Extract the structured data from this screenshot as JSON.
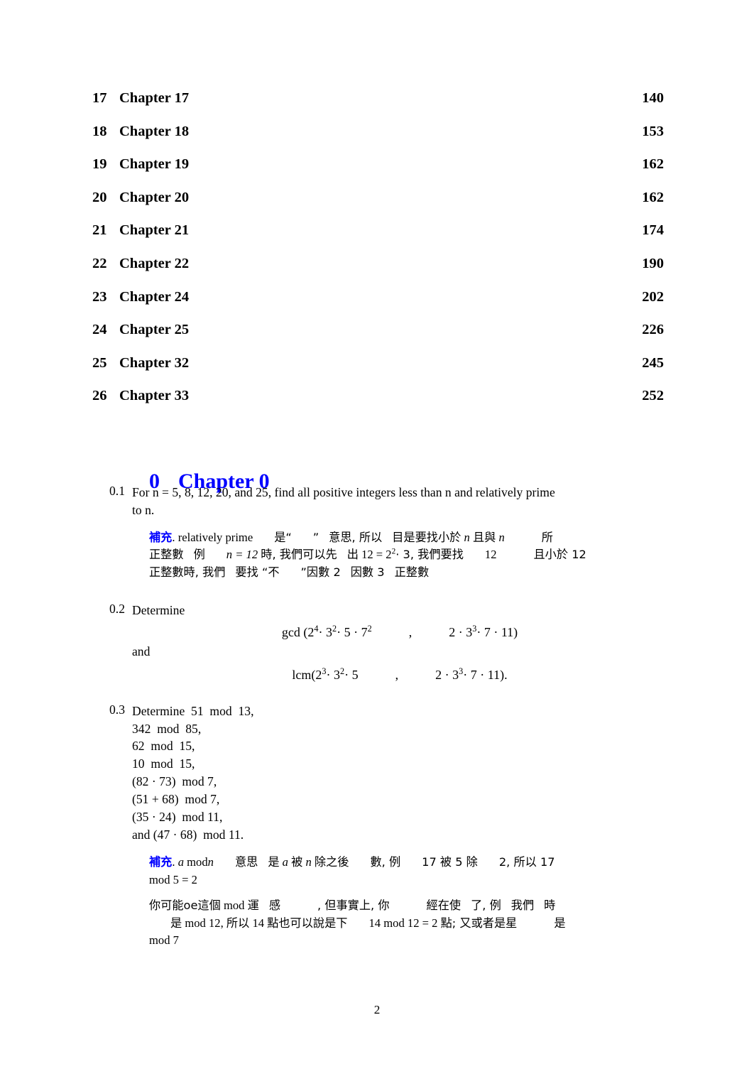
{
  "document": {
    "page_number": "2",
    "accent_color": "#0000ff",
    "text_color": "#000000"
  },
  "toc": {
    "entries": [
      {
        "number": "17",
        "title": "Chapter 17",
        "page": "140"
      },
      {
        "number": "18",
        "title": "Chapter 18",
        "page": "153"
      },
      {
        "number": "19",
        "title": "Chapter 19",
        "page": "162"
      },
      {
        "number": "20",
        "title": "Chapter 20",
        "page": "162"
      },
      {
        "number": "21",
        "title": "Chapter 21",
        "page": "174"
      },
      {
        "number": "22",
        "title": "Chapter 22",
        "page": "190"
      },
      {
        "number": "23",
        "title": "Chapter 24",
        "page": "202"
      },
      {
        "number": "24",
        "title": "Chapter 25",
        "page": "226"
      },
      {
        "number": "25",
        "title": "Chapter 32",
        "page": "245"
      },
      {
        "number": "26",
        "title": "Chapter 33",
        "page": "252"
      }
    ]
  },
  "chapter": {
    "number": "0",
    "title": "Chapter 0"
  },
  "problems": {
    "p1": {
      "label": "0.1",
      "line1": "For n = 5, 8, 12, 20, and 25, find all positive integers less than n and relatively prime",
      "line2": "to n.",
      "note": {
        "tag": "補充",
        "tag_period": ".",
        "line1_a": "relatively prime",
        "line1_b": "是“",
        "line1_c": "”",
        "line1_d": "意思, 所以",
        "line1_e": "目是要找小於",
        "line1_f": "n",
        "line1_g": "且與",
        "line1_h": "n",
        "line1_i": "所",
        "line2_a": "正整數",
        "line2_b": "例",
        "line2_c": "n = 12",
        "line2_d": "時, 我們可以先",
        "line2_e": "出",
        "line2_f": "12 = 2",
        "line2_g": "2",
        "line2_h": "· 3, 我們要找",
        "line2_i": "12",
        "line2_j": "且小於 12",
        "line3_a": "正整數時, 我們",
        "line3_b": "要找 “不",
        "line3_c": "”因數 2",
        "line3_d": "因數 3",
        "line3_e": "正整數"
      }
    },
    "p2": {
      "label": "0.2",
      "intro": "Determine",
      "eq1_prefix": "gcd (2",
      "eq1_e1": "4",
      "eq1_m1": "· 3",
      "eq1_e2": "2",
      "eq1_m2": "· 5 · 7",
      "eq1_e3": "2",
      "eq1_comma": ",",
      "eq1_right_a": "2 · 3",
      "eq1_e4": "3",
      "eq1_right_b": "· 7 · 11)",
      "and": "and",
      "eq2_prefix": "lcm(2",
      "eq2_e1": "3",
      "eq2_m1": "· 3",
      "eq2_e2": "2",
      "eq2_m2": "· 5",
      "eq2_comma": ",",
      "eq2_right_a": "2 · 3",
      "eq2_e3": "3",
      "eq2_right_b": "· 7 · 11)."
    },
    "p3": {
      "label": "0.3",
      "line1": "Determine  51  mod  13,",
      "items": [
        "342  mod  85,",
        "62  mod  15,",
        "10  mod  15,",
        "(82 · 73)  mod 7,",
        "(51 + 68)  mod 7,",
        "(35 · 24)  mod 11,",
        "and (47 · 68)  mod 11."
      ],
      "note1": {
        "tag": "補充",
        "tag_period": ".",
        "a": "a",
        "b": "mod",
        "c": "n",
        "d": "意思",
        "e": "是",
        "f": "a",
        "g": "被",
        "h": "n",
        "i": "除之後",
        "j": "數, 例",
        "k": "17 被 5 除",
        "l": "2, 所以 17",
        "line2": "mod 5 = 2"
      },
      "note2": {
        "l1_a": "你可能oe這個",
        "l1_b": "mod",
        "l1_c": "運",
        "l1_d": "感",
        "l1_e": ", 但事實上, 你",
        "l1_f": "經在使",
        "l1_g": "了, 例",
        "l1_h": "我們",
        "l1_i": "時",
        "l2_a": "是",
        "l2_b": "mod 12,",
        "l2_c": "所以",
        "l2_d": "14",
        "l2_e": "點也可以說是下",
        "l2_f": "14 mod 12 = 2",
        "l2_g": "點; 又或者是星",
        "l2_h": "是",
        "l3": "mod 7"
      }
    }
  }
}
